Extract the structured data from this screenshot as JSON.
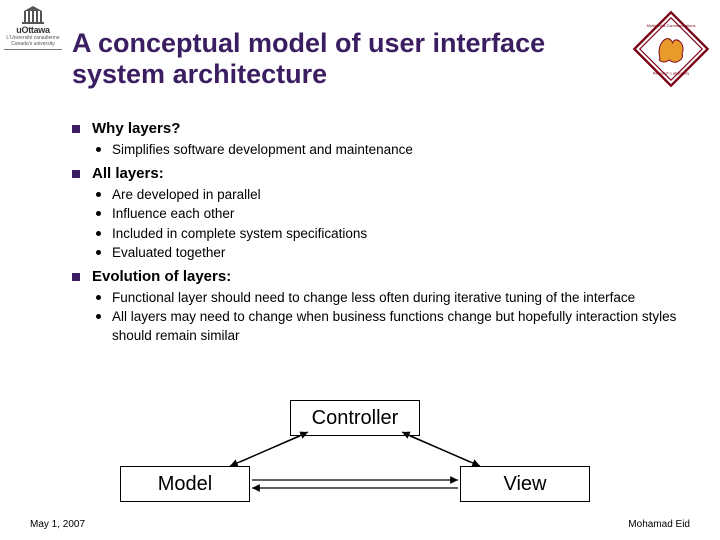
{
  "title": "A conceptual model of user interface system architecture",
  "logo_left": {
    "name": "uOttawa",
    "tagline1": "L'Université canadienne",
    "tagline2": "Canada's university"
  },
  "bullets": {
    "b1": {
      "label": "Why layers?",
      "items": {
        "i1": "Simplifies software development and maintenance"
      }
    },
    "b2": {
      "label": "All layers:",
      "items": {
        "i1": "Are developed in parallel",
        "i2": "Influence each other",
        "i3": "Included in complete system specifications",
        "i4": "Evaluated together"
      }
    },
    "b3": {
      "label": "Evolution of layers:",
      "items": {
        "i1": "Functional layer should need to change less often during iterative tuning of the interface",
        "i2": "All layers may need to change when business functions change but hopefully interaction styles should remain similar"
      }
    }
  },
  "diagram": {
    "controller": "Controller",
    "model": "Model",
    "view": "View"
  },
  "footer": {
    "left": "May 1, 2007",
    "right": "Mohamad Eid"
  }
}
